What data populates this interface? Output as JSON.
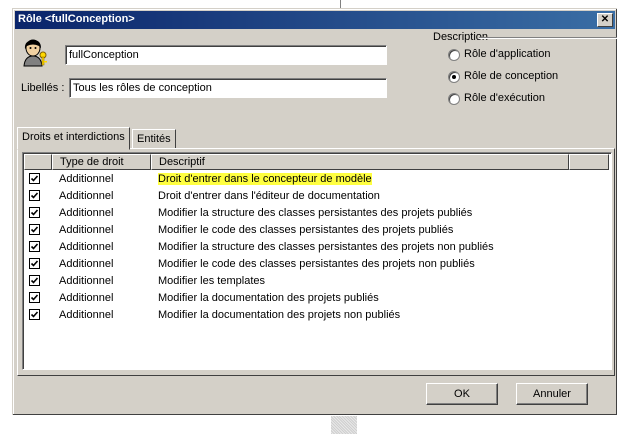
{
  "window": {
    "title": "Rôle <fullConception>",
    "close_glyph": "✕"
  },
  "identity": {
    "name_value": "fullConception",
    "libelles_label": "Libellés :",
    "libelles_value": "Tous les rôles de conception"
  },
  "description": {
    "legend": "Description",
    "options": [
      {
        "label": "Rôle d'application",
        "selected": false
      },
      {
        "label": "Rôle de conception",
        "selected": true
      },
      {
        "label": "Rôle d'exécution",
        "selected": false
      }
    ]
  },
  "tabs": [
    {
      "label": "Droits et interdictions",
      "active": true
    },
    {
      "label": "Entités",
      "active": false
    }
  ],
  "table": {
    "columns": [
      "",
      "Type de droit",
      "Descriptif",
      ""
    ],
    "rows": [
      {
        "checked": true,
        "type": "Additionnel",
        "desc": "Droit d'entrer dans le concepteur de modèle",
        "highlight": true
      },
      {
        "checked": true,
        "type": "Additionnel",
        "desc": "Droit d'entrer dans l'éditeur de documentation",
        "highlight": false
      },
      {
        "checked": true,
        "type": "Additionnel",
        "desc": "Modifier la structure des classes persistantes des projets publiés",
        "highlight": false
      },
      {
        "checked": true,
        "type": "Additionnel",
        "desc": "Modifier le code des classes persistantes des projets publiés",
        "highlight": false
      },
      {
        "checked": true,
        "type": "Additionnel",
        "desc": "Modifier la structure des classes persistantes des projets non publiés",
        "highlight": false
      },
      {
        "checked": true,
        "type": "Additionnel",
        "desc": "Modifier le code des classes persistantes des projets non publiés",
        "highlight": false
      },
      {
        "checked": true,
        "type": "Additionnel",
        "desc": "Modifier les templates",
        "highlight": false
      },
      {
        "checked": true,
        "type": "Additionnel",
        "desc": "Modifier la documentation des projets publiés",
        "highlight": false
      },
      {
        "checked": true,
        "type": "Additionnel",
        "desc": "Modifier la documentation des projets non publiés",
        "highlight": false
      }
    ]
  },
  "buttons": {
    "ok": "OK",
    "cancel": "Annuler"
  },
  "colors": {
    "titlebar": "#0a246a",
    "highlight": "#ffff40",
    "face": "#d4d0c8"
  },
  "icons": {
    "user": "user-key-icon",
    "close": "close-icon",
    "check": "checkmark-icon"
  }
}
